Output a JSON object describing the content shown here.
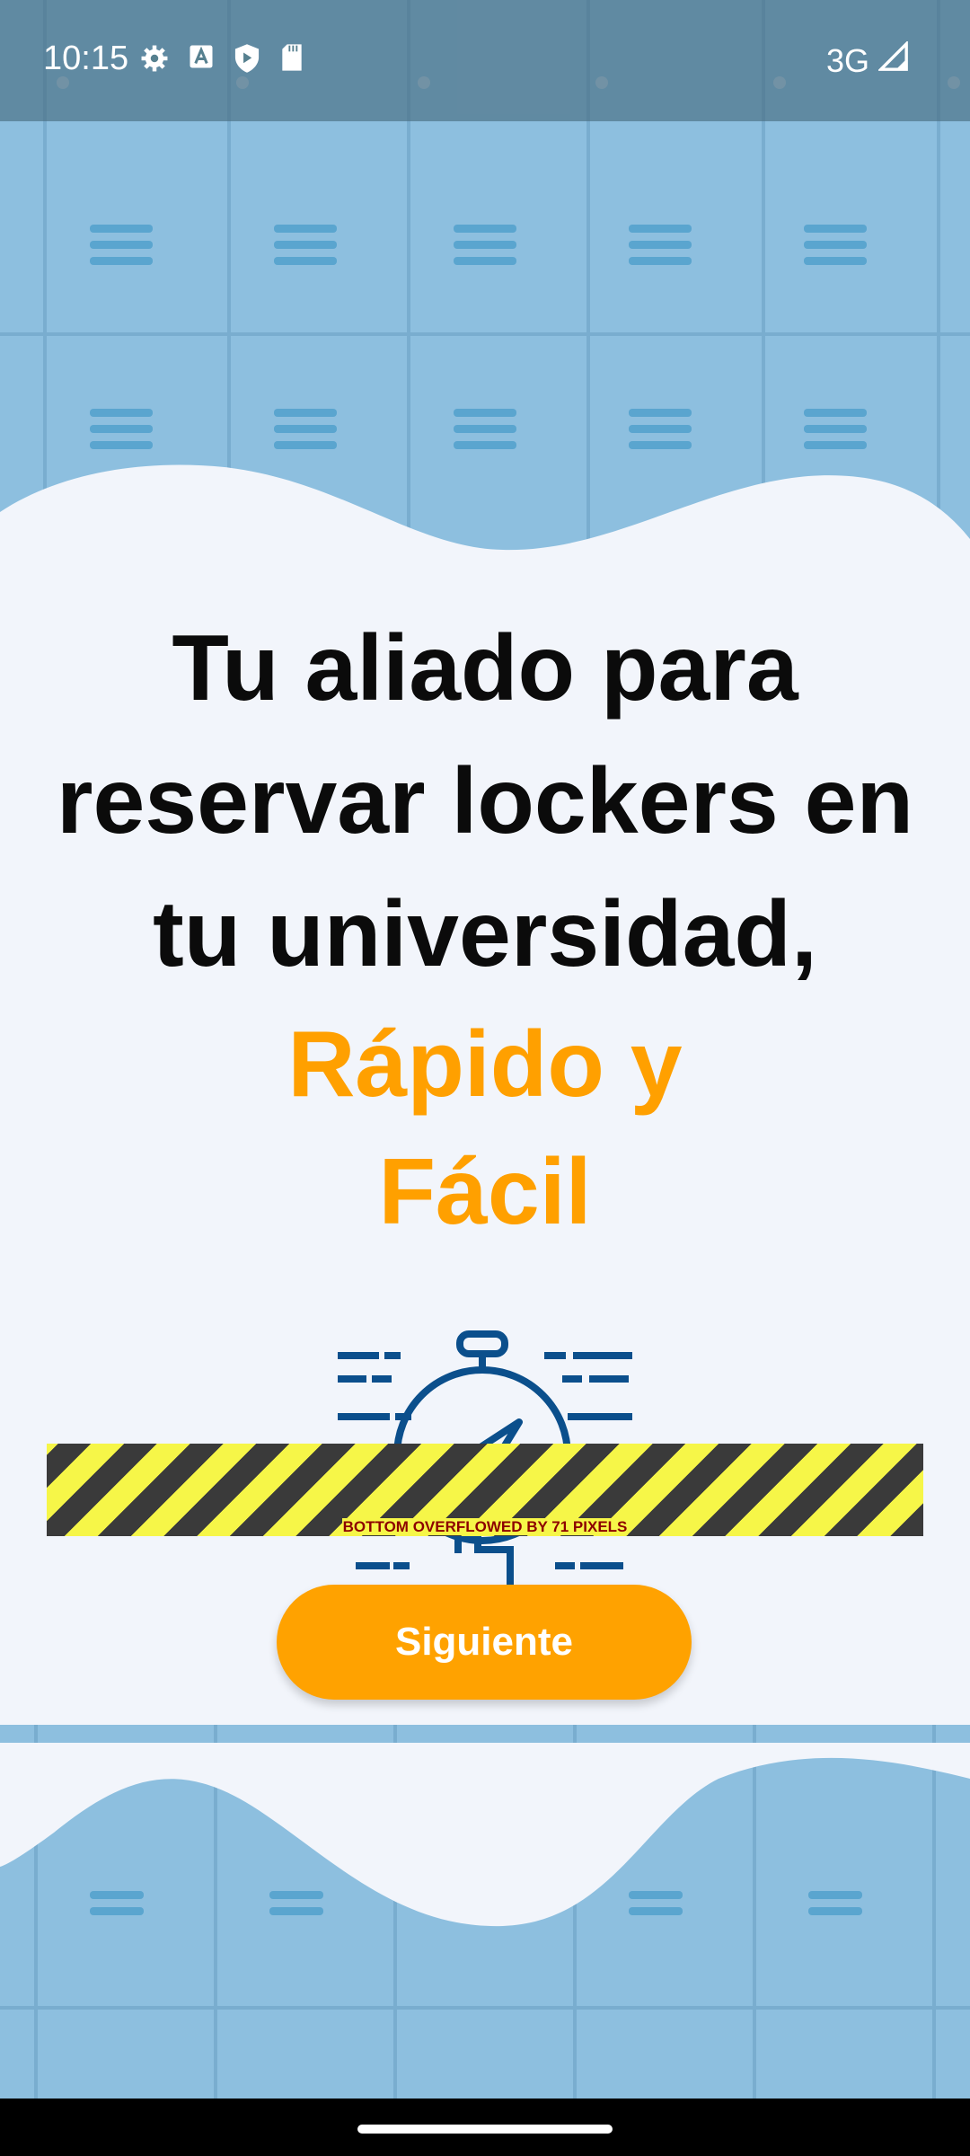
{
  "status_bar": {
    "time": "10:15",
    "network": "3G",
    "left_icons": [
      "gear-icon",
      "text-a-icon",
      "shield-play-icon",
      "sd-card-icon"
    ],
    "right_icons": [
      "signal-icon"
    ]
  },
  "headline": {
    "line1": "Tu aliado para",
    "line2": "reservar lockers en",
    "line3": "tu universidad,",
    "accent1": "Rápido y",
    "accent2": "Fácil"
  },
  "illustration": {
    "icon": "fast-stopwatch-icon"
  },
  "overflow_warning": {
    "text": "BOTTOM OVERFLOWED BY 71 PIXELS"
  },
  "actions": {
    "next_label": "Siguiente"
  },
  "colors": {
    "accent": "#ffa000",
    "button": "#ffa200",
    "icon_blue": "#0b4f8c",
    "background": "#f2f5fb",
    "locker_blue": "#8dbfdf"
  }
}
